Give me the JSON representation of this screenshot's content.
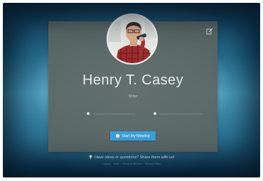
{
  "profile": {
    "name": "Henry T. Casey",
    "subtitle": "Writer",
    "meta_left": "",
    "meta_right": ""
  },
  "actions": {
    "start_meeting": "Start My Meeting"
  },
  "footer": {
    "feedback": "Have ideas or questions? Share them with us!",
    "links": [
      "Logout",
      "Help",
      "Terms of Service",
      "Privacy Policy"
    ]
  },
  "colors": {
    "accent": "#3aa0dc",
    "card": "#5c6664",
    "background_center": "#bfe7f2",
    "background_edge": "#0b2c43"
  },
  "icons": {
    "edit": "edit-icon",
    "location": "location-icon",
    "clock": "clock-icon",
    "camera": "camera-icon",
    "bulb": "lightbulb-icon"
  }
}
